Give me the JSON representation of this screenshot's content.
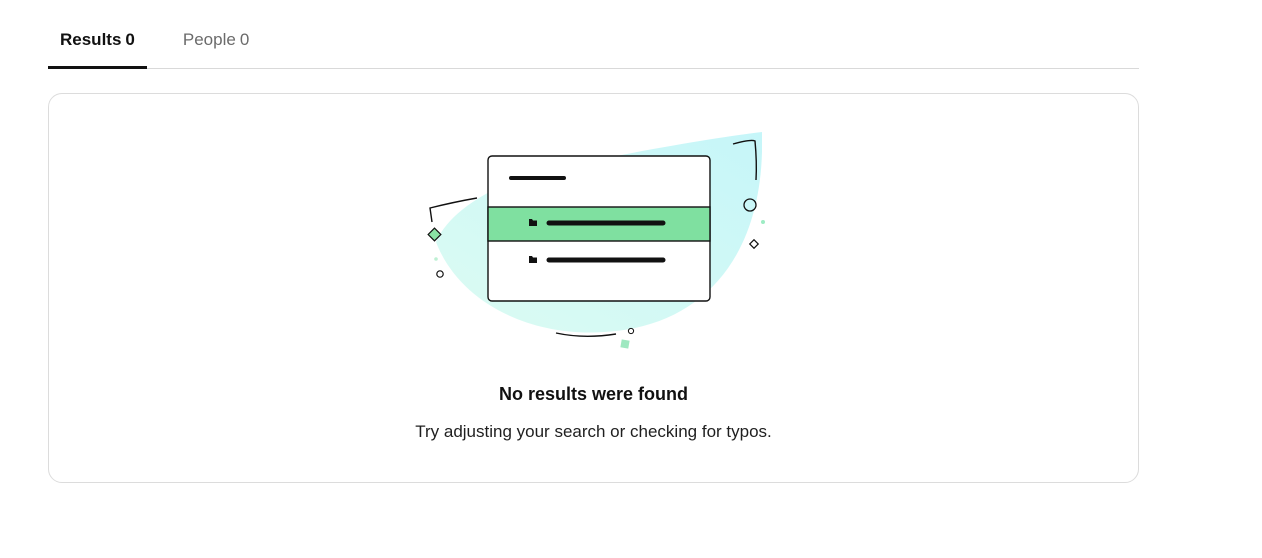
{
  "tabs": [
    {
      "label": "Results",
      "count": "0",
      "active": true
    },
    {
      "label": "People",
      "count": "0",
      "active": false
    }
  ],
  "empty_state": {
    "illustration_icon": "empty-search-results-illustration",
    "title": "No results were found",
    "subtitle": "Try adjusting your search or checking for typos."
  },
  "colors": {
    "accent_green": "#7fe0a0",
    "blob_mint": "#d8fbf5",
    "blob_cyan": "#c9f7f8",
    "tab_underline": "#111111",
    "card_border": "#dcdcdc"
  }
}
